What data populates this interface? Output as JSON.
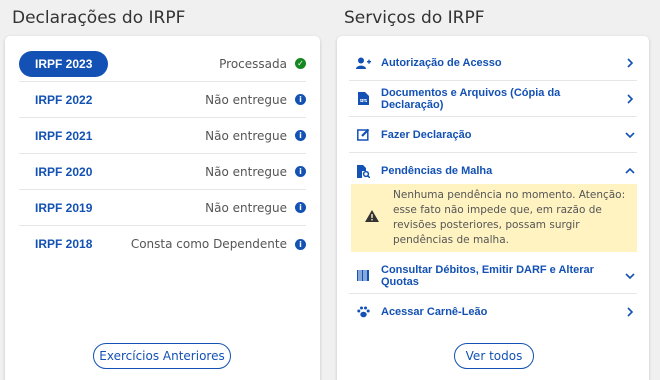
{
  "left": {
    "title": "Declarações do IRPF",
    "years": [
      {
        "label": "IRPF 2023",
        "status": "Processada",
        "icon": "check-circle-icon"
      },
      {
        "label": "IRPF 2022",
        "status": "Não entregue",
        "icon": "info-icon"
      },
      {
        "label": "IRPF 2021",
        "status": "Não entregue",
        "icon": "info-icon"
      },
      {
        "label": "IRPF 2020",
        "status": "Não entregue",
        "icon": "info-icon"
      },
      {
        "label": "IRPF 2019",
        "status": "Não entregue",
        "icon": "info-icon"
      },
      {
        "label": "IRPF 2018",
        "status": "Consta como Dependente",
        "icon": "info-icon"
      }
    ],
    "button_label": "Exercícios Anteriores"
  },
  "right": {
    "title": "Serviços do IRPF",
    "items": [
      {
        "label": "Autorização de Acesso",
        "icon": "add-user-icon",
        "chevron": "chevron-right-icon"
      },
      {
        "label": "Documentos e Arquivos (Cópia da Declaração)",
        "icon": "pdf-file-icon",
        "chevron": "chevron-right-icon"
      },
      {
        "label": "Fazer Declaração",
        "icon": "edit-icon",
        "chevron": "chevron-down-icon"
      },
      {
        "label": "Pendências de Malha",
        "icon": "file-search-icon",
        "chevron": "chevron-up-icon"
      },
      {
        "label": "Consultar Débitos, Emitir DARF e Alterar Quotas",
        "icon": "barcode-icon",
        "chevron": "chevron-down-icon"
      },
      {
        "label": "Acessar Carnê-Leão",
        "icon": "paw-icon",
        "chevron": "chevron-right-icon"
      }
    ],
    "warning_text": "Nenhuma pendência no momento. Atenção: esse fato não impede que, em razão de revisões posteriores, possam surgir pendências de malha.",
    "button_label": "Ver todos"
  },
  "colors": {
    "primary": "#1351b4",
    "success": "#168821",
    "warning_bg": "#fff3c2"
  }
}
